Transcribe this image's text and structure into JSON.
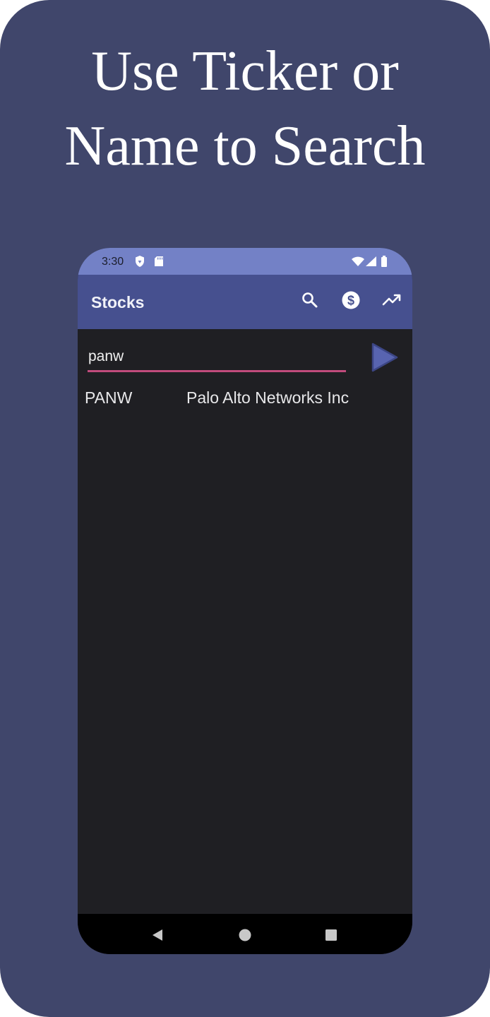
{
  "promo": {
    "headline_line1": "Use Ticker or",
    "headline_line2": "Name to Search",
    "background_color": "#40466b"
  },
  "status_bar": {
    "time": "3:30",
    "left_icons": [
      "shield-icon",
      "sd-card-icon"
    ],
    "right_icons": [
      "wifi-icon",
      "signal-icon",
      "battery-icon"
    ],
    "color": "#7381c6"
  },
  "app_bar": {
    "title": "Stocks",
    "actions": [
      "search-icon",
      "dollar-icon",
      "trending-up-icon"
    ],
    "color": "#46508f"
  },
  "search": {
    "value": "panw",
    "underline_color": "#c14b7c",
    "submit_icon": "play-arrow-icon"
  },
  "results": [
    {
      "ticker": "PANW",
      "name": "Palo Alto Networks Inc"
    }
  ],
  "nav_bar": {
    "icons": [
      "back-icon",
      "home-icon",
      "recents-icon"
    ]
  }
}
